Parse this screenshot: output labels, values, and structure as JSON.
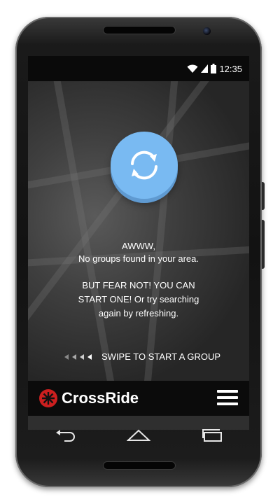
{
  "status": {
    "time": "12:35"
  },
  "empty_state": {
    "line1": "AWWW,",
    "line2": "No groups found in your area.",
    "line3": "BUT FEAR NOT! YOU CAN",
    "line4": "START ONE!  Or try searching",
    "line5": "again by refreshing."
  },
  "swipe_hint": "SWIPE TO START A GROUP",
  "app": {
    "brand": "CrossRide"
  },
  "colors": {
    "accent_blue": "#79baf2",
    "brand_red": "#cc1f1f",
    "bar_black": "#0b0b0b"
  },
  "icons": {
    "refresh": "refresh-icon",
    "menu": "hamburger-menu-icon",
    "back": "back-icon",
    "home": "home-icon",
    "recents": "recent-apps-icon"
  }
}
